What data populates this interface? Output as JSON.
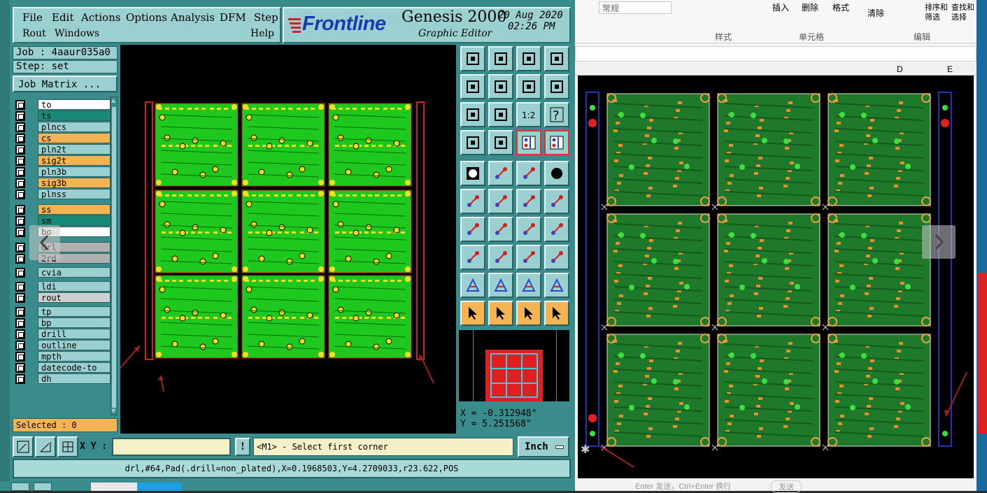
{
  "menu": {
    "file": "File",
    "edit": "Edit",
    "actions": "Actions",
    "options": "Options",
    "analysis": "Analysis",
    "dfm": "DFM",
    "step": "Step",
    "rout": "Rout",
    "windows": "Windows",
    "help": "Help"
  },
  "header": {
    "brand": "Frontline",
    "product": "Genesis 2000",
    "subtitle": "Graphic Editor",
    "date": "20 Aug 2020",
    "time": "02:26 PM"
  },
  "job": {
    "job_label": "Job : 4aaur035a0",
    "step_label": "Step: set",
    "matrix_button": "Job Matrix ..."
  },
  "layers": [
    {
      "name": "to",
      "color": "#ffffff"
    },
    {
      "name": "ts",
      "color": "#1a8a78"
    },
    {
      "name": "plncs",
      "color": "#9bd0d0"
    },
    {
      "name": "cs",
      "color": "#f5b453"
    },
    {
      "name": "pln2t",
      "color": "#9bd0d0"
    },
    {
      "name": "sig2t",
      "color": "#f5b453"
    },
    {
      "name": "pln3b",
      "color": "#9bd0d0"
    },
    {
      "name": "sig3b",
      "color": "#f5b453"
    },
    {
      "name": "plnss",
      "color": "#9bd0d0"
    },
    {
      "name": "ss",
      "color": "#f5b453"
    },
    {
      "name": "sm",
      "color": "#1a8a78"
    },
    {
      "name": "bo",
      "color": "#ffffff"
    },
    {
      "name": "drl",
      "color": "#b0b0b0"
    },
    {
      "name": "2rd",
      "color": "#b0b0b0"
    },
    {
      "name": "cvia",
      "color": "#9bd0d0"
    },
    {
      "name": "ldi",
      "color": "#9bd0d0"
    },
    {
      "name": "rout",
      "color": "#d0d0d0"
    },
    {
      "name": "tp",
      "color": "#9bd0d0"
    },
    {
      "name": "bp",
      "color": "#9bd0d0"
    },
    {
      "name": "drill",
      "color": "#9bd0d0"
    },
    {
      "name": "outline",
      "color": "#9bd0d0"
    },
    {
      "name": "mpth",
      "color": "#9bd0d0"
    },
    {
      "name": "datecode-to",
      "color": "#9bd0d0"
    },
    {
      "name": "dh",
      "color": "#9bd0d0"
    }
  ],
  "selected": "Selected : 0",
  "coords": {
    "x": "X = -0.312948\"",
    "y": "Y = 5.251568\""
  },
  "cmd": {
    "xy_label": "X Y :",
    "xy_value": "",
    "prompt": "<M1> - Select first corner",
    "unit": "Inch"
  },
  "status_text": "drl,#64,Pad(.drill=non_plated),X=0.1968503,Y=4.2709033,r23.622,POS",
  "excel": {
    "ribbon_groups": [
      "样式",
      "单元格",
      "编辑"
    ],
    "ribbon_buttons": [
      "插入",
      "删除",
      "格式",
      "清除",
      "排序和筛选",
      "查找和选择"
    ],
    "style_box": "常规",
    "col_d": "D",
    "col_e": "E",
    "bottom_hint": "Enter 发送，Ctrl+Enter 换行",
    "send": "发送"
  }
}
